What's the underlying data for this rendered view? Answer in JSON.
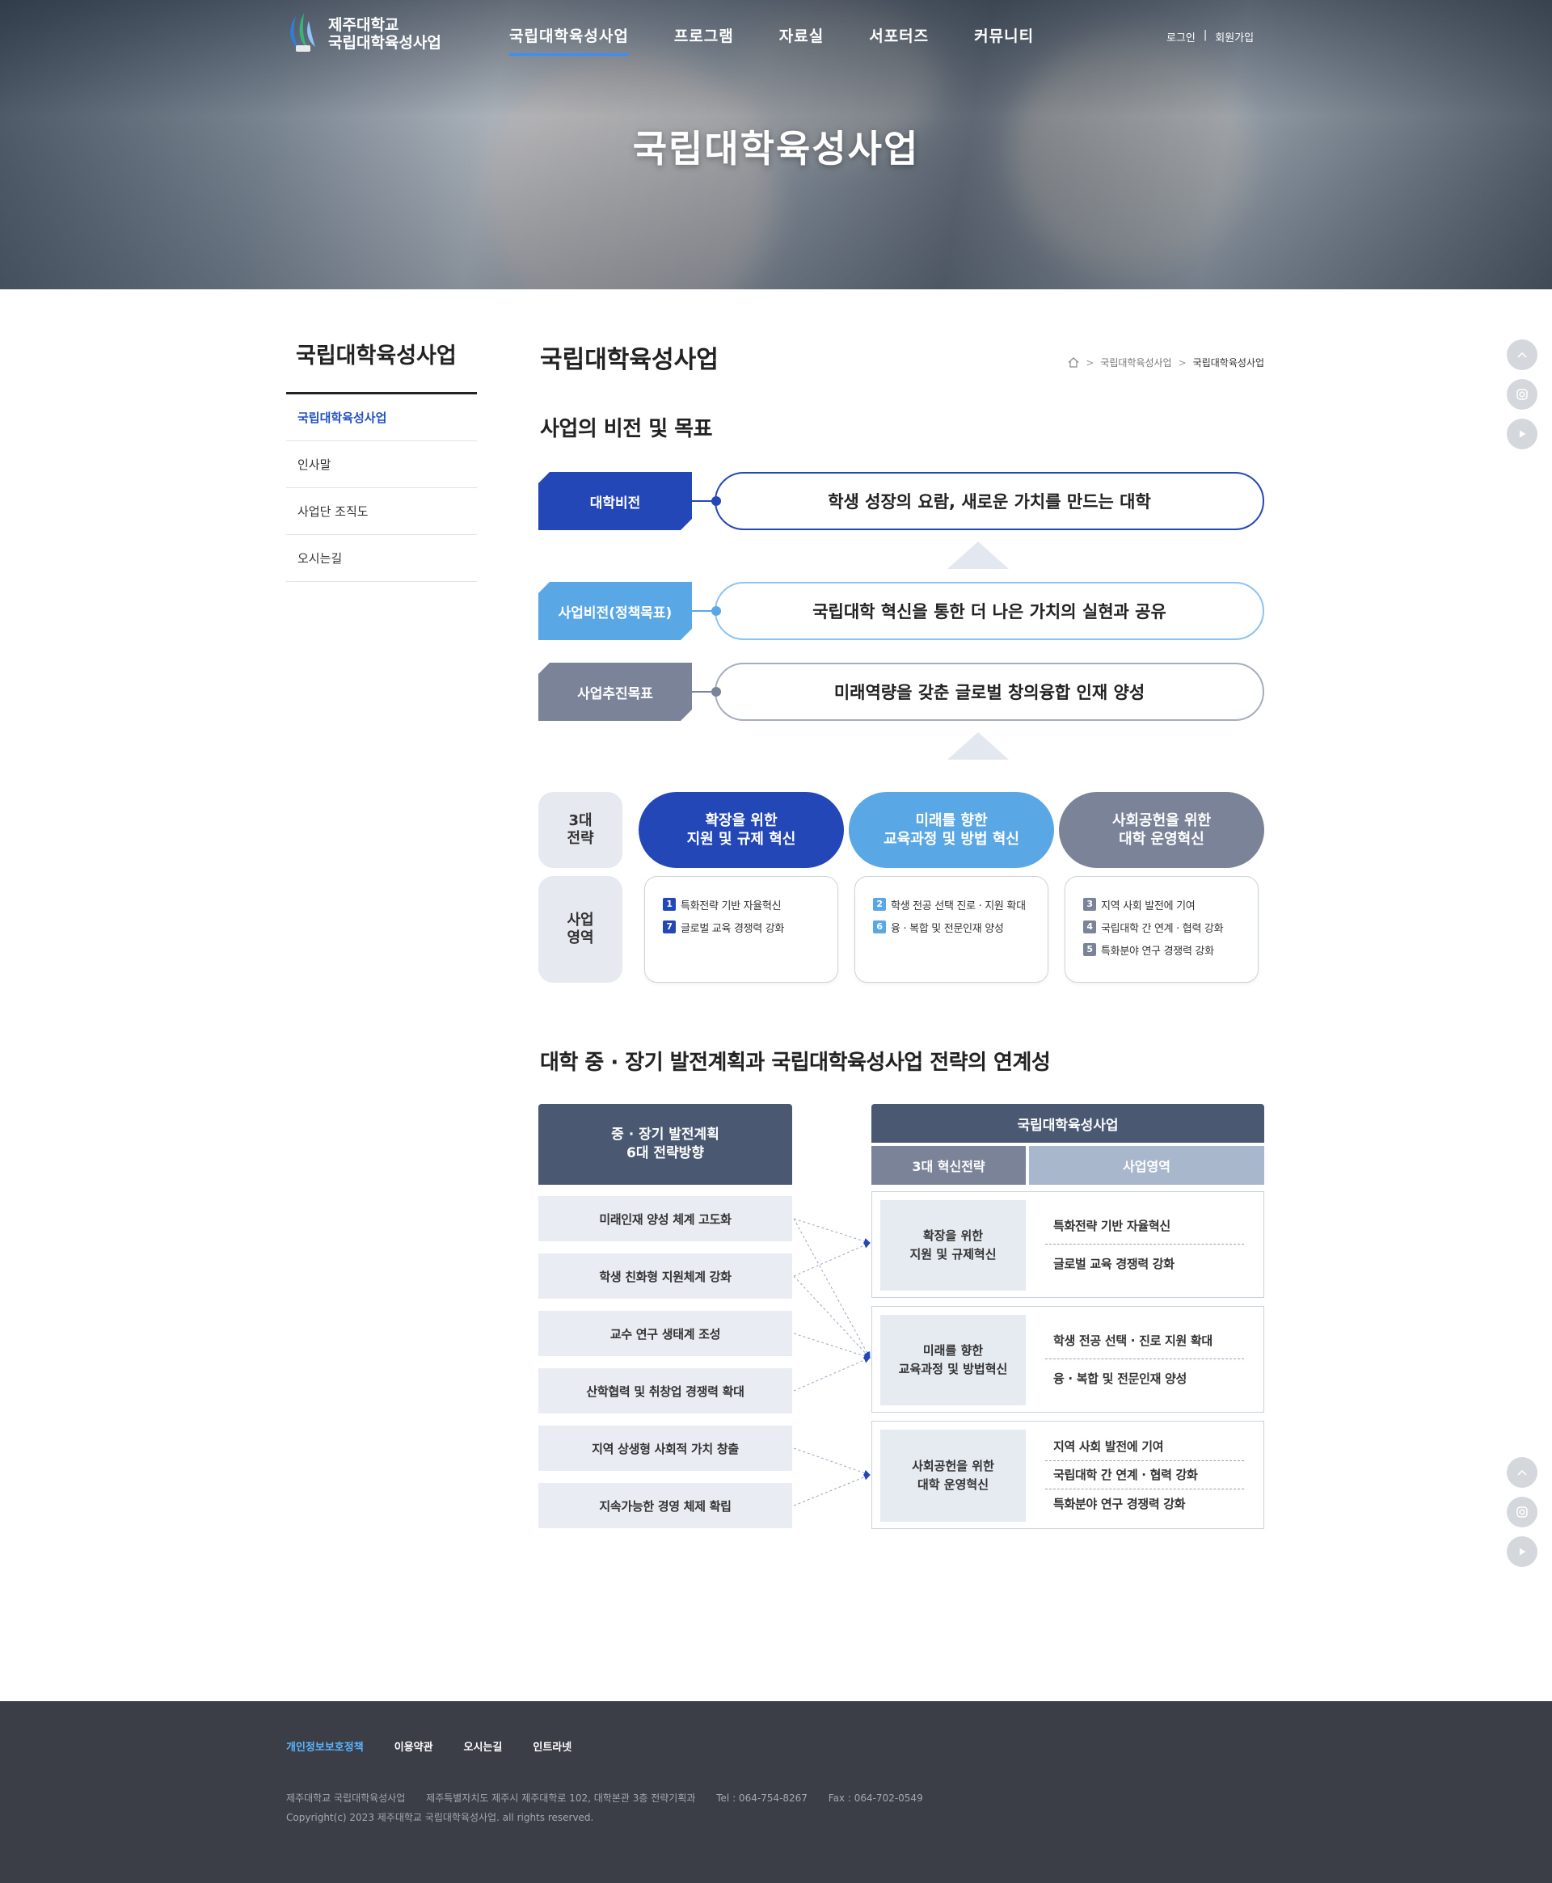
{
  "header": {
    "logo_line1": "제주대학교",
    "logo_line2": "국립대학육성사업",
    "nav": [
      "국립대학육성사업",
      "프로그램",
      "자료실",
      "서포터즈",
      "커뮤니티"
    ],
    "util": {
      "login": "로그인",
      "divider": "|",
      "join": "회원가입"
    },
    "hero_title": "국립대학육성사업"
  },
  "sidebar": {
    "title": "국립대학육성사업",
    "items": [
      "국립대학육성사업",
      "인사말",
      "사업단 조직도",
      "오시는길"
    ]
  },
  "content": {
    "page_title": "국립대학육성사업",
    "breadcrumb": [
      "국립대학육성사업",
      "국립대학육성사업"
    ],
    "section1_title": "사업의 비전 및 목표",
    "vision": [
      {
        "tag": "대학비전",
        "text": "학생 성장의 요람, 새로운 가치를 만드는 대학"
      },
      {
        "tag": "사업비전(정책목표)",
        "text": "국립대학 혁신을 통한 더 나은 가치의 실현과 공유"
      },
      {
        "tag": "사업추진목표",
        "text": "미래역량을 갖춘 글로벌 창의융합 인재 양성"
      }
    ],
    "label_strategy_l1": "3대",
    "label_strategy_l2": "전략",
    "label_area_l1": "사업",
    "label_area_l2": "영역",
    "strategies": [
      {
        "l1": "확장을 위한",
        "l2": "지원 및 규제 혁신"
      },
      {
        "l1": "미래를 향한",
        "l2": "교육과정 및 방법 혁신"
      },
      {
        "l1": "사회공헌을 위한",
        "l2": "대학 운영혁신"
      }
    ],
    "areas": [
      [
        {
          "n": "1",
          "t": "특화전략 기반 자율혁신"
        },
        {
          "n": "7",
          "t": "글로벌 교육 경쟁력 강화"
        }
      ],
      [
        {
          "n": "2",
          "t": "학생 전공 선택 진로 · 지원 확대"
        },
        {
          "n": "6",
          "t": "융 · 복합 및 전문인재 양성"
        }
      ],
      [
        {
          "n": "3",
          "t": "지역 사회 발전에 기여"
        },
        {
          "n": "4",
          "t": "국립대학 간 연계 · 협력 강화"
        },
        {
          "n": "5",
          "t": "특화분야 연구 경쟁력 강화"
        }
      ]
    ],
    "section2_title": "대학 중 · 장기 발전계획과 국립대학육성사업 전략의 연계성",
    "linkage": {
      "left_head_l1": "중 · 장기 발전계획",
      "left_head_l2": "6대 전략방향",
      "left_items": [
        "미래인재 양성 체계 고도화",
        "학생 친화형 지원체계 강화",
        "교수 연구 생태계 조성",
        "산학협력 및 취창업 경쟁력 확대",
        "지역 상생형 사회적 가치 창출",
        "지속가능한 경영 체제 확립"
      ],
      "right_head": "국립대학육성사업",
      "sub_strategy": "3대 혁신전략",
      "sub_area": "사업영역",
      "groups": [
        {
          "s1": "확장을 위한",
          "s2": "지원 및 규제혁신",
          "areas": [
            "특화전략 기반 자율혁신",
            "글로벌 교육 경쟁력 강화"
          ]
        },
        {
          "s1": "미래를 향한",
          "s2": "교육과정 및 방법혁신",
          "areas": [
            "학생 전공 선택 · 진로 지원 확대",
            "융 · 복합 및 전문인재 양성"
          ]
        },
        {
          "s1": "사회공헌을 위한",
          "s2": "대학 운영혁신",
          "areas": [
            "지역 사회 발전에 기여",
            "국립대학 간 연계 · 협력 강화",
            "특화분야 연구 경쟁력 강화"
          ]
        }
      ]
    }
  },
  "footer": {
    "links": [
      "개인정보보호정책",
      "이용약관",
      "오시는길",
      "인트라넷"
    ],
    "org": "제주대학교 국립대학육성사업",
    "address": "제주특별자치도 제주시 제주대학로 102, 대학본관 3층 전략기획과",
    "tel": "Tel : 064-754-8267",
    "fax": "Fax : 064-702-0549",
    "copyright": "Copyright(c) 2023 제주대학교 국립대학육성사업. all rights reserved."
  },
  "colors": {
    "primary": "#2447b8",
    "light_blue": "#5aa7e6",
    "gray_blue": "#7a8398",
    "navy": "#4a5872"
  },
  "icons": [
    "home-icon",
    "chevron-right-icon",
    "arrow-up-icon",
    "instagram-icon",
    "youtube-icon"
  ]
}
